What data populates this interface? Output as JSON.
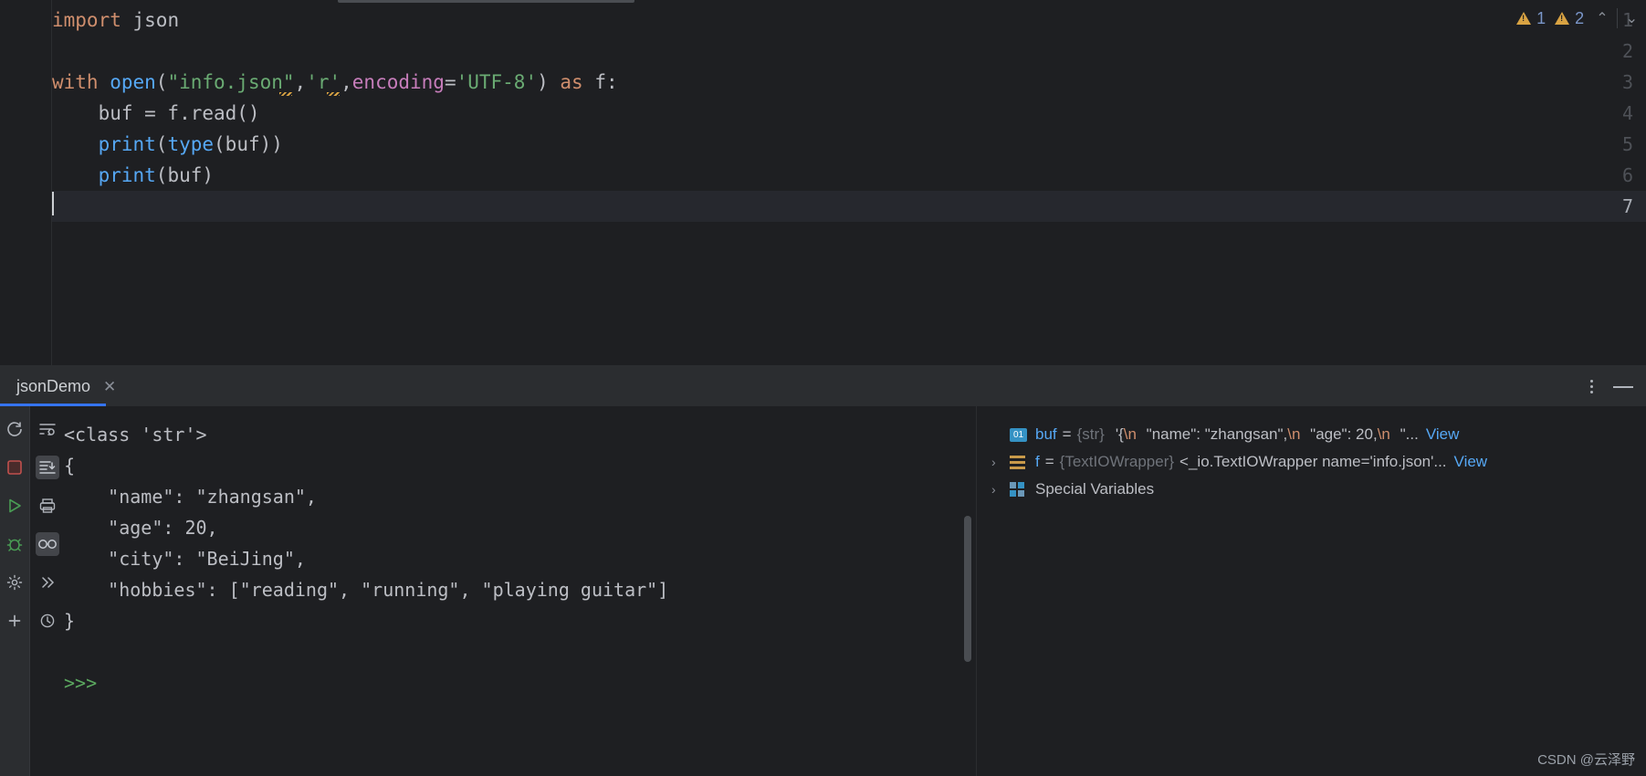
{
  "editor": {
    "lines": [
      {
        "number": "1",
        "tokens": [
          {
            "t": "import ",
            "c": "kw"
          },
          {
            "t": "json",
            "c": "plain"
          }
        ]
      },
      {
        "number": "2",
        "tokens": []
      },
      {
        "number": "3",
        "tokens": [
          {
            "t": "with ",
            "c": "kw"
          },
          {
            "t": "open",
            "c": "fn"
          },
          {
            "t": "(",
            "c": "plain"
          },
          {
            "t": "\"info.json\"",
            "c": "str"
          },
          {
            "t": ",",
            "c": "plain"
          },
          {
            "t": "'r'",
            "c": "str"
          },
          {
            "t": ",",
            "c": "plain"
          },
          {
            "t": "encoding",
            "c": "param"
          },
          {
            "t": "=",
            "c": "plain"
          },
          {
            "t": "'UTF-8'",
            "c": "str"
          },
          {
            "t": ") ",
            "c": "plain"
          },
          {
            "t": "as",
            "c": "kw"
          },
          {
            "t": " f:",
            "c": "plain"
          }
        ]
      },
      {
        "number": "4",
        "tokens": [
          {
            "t": "    buf = f.read()",
            "c": "plain"
          }
        ]
      },
      {
        "number": "5",
        "tokens": [
          {
            "t": "    ",
            "c": "plain"
          },
          {
            "t": "print",
            "c": "fn"
          },
          {
            "t": "(",
            "c": "plain"
          },
          {
            "t": "type",
            "c": "fn"
          },
          {
            "t": "(buf))",
            "c": "plain"
          }
        ]
      },
      {
        "number": "6",
        "tokens": [
          {
            "t": "    ",
            "c": "plain"
          },
          {
            "t": "print",
            "c": "fn"
          },
          {
            "t": "(buf)",
            "c": "plain"
          }
        ]
      },
      {
        "number": "7",
        "tokens": []
      }
    ],
    "current_line": "7",
    "inspections": {
      "warning_count_1": "1",
      "warning_count_2": "2",
      "prev_label": "⌃",
      "next_label": "⌄"
    }
  },
  "run_window": {
    "tab_label": "jsonDemo",
    "tab_close_label": "✕",
    "left_rail": [
      {
        "name": "rerun-icon",
        "glyph": "rerun"
      },
      {
        "name": "stop-icon",
        "glyph": "stop"
      },
      {
        "name": "run-icon",
        "glyph": "run"
      },
      {
        "name": "debug-icon",
        "glyph": "debug"
      },
      {
        "name": "settings-icon",
        "glyph": "gear"
      },
      {
        "name": "add-icon",
        "glyph": "plus"
      }
    ],
    "second_rail": [
      {
        "name": "soft-wrap-icon",
        "glyph": "wrap"
      },
      {
        "name": "scroll-to-end-icon",
        "glyph": "scrollend"
      },
      {
        "name": "print-icon",
        "glyph": "print"
      },
      {
        "name": "show-variables-icon",
        "glyph": "glasses"
      },
      {
        "name": "more-icon",
        "glyph": "chevrons"
      },
      {
        "name": "history-icon",
        "glyph": "clock"
      }
    ],
    "console_output": [
      {
        "text": "<class 'str'>",
        "style": "normal"
      },
      {
        "text": "{",
        "style": "normal"
      },
      {
        "text": "    \"name\": \"zhangsan\",",
        "style": "normal"
      },
      {
        "text": "    \"age\": 20,",
        "style": "normal"
      },
      {
        "text": "    \"city\": \"BeiJing\",",
        "style": "normal"
      },
      {
        "text": "    \"hobbies\": [\"reading\", \"running\", \"playing guitar\"]",
        "style": "normal"
      },
      {
        "text": "}",
        "style": "normal"
      },
      {
        "text": "",
        "style": "normal"
      },
      {
        "text": ">>>",
        "style": "prompt"
      }
    ],
    "more_options_label": "⋮",
    "minimize_label": "—"
  },
  "variables": {
    "rows": [
      {
        "expandable": false,
        "arrow": "",
        "icon": "badge-01",
        "name": "buf",
        "eq": "=",
        "type": "{str}",
        "value_pre": "'{",
        "value_esc1": "\\n",
        "value_mid1": "    \"name\": \"zhangsan\",",
        "value_esc2": "\\n",
        "value_mid2": "    \"age\": 20,",
        "value_esc3": "\\n",
        "value_tail": "    \"",
        "ellipsis": "...",
        "view_label": "View"
      },
      {
        "expandable": true,
        "arrow": "›",
        "icon": "lines",
        "name": "f",
        "eq": "=",
        "type": "{TextIOWrapper}",
        "value": "<_io.TextIOWrapper name='info.json'",
        "ellipsis": "...",
        "view_label": "View"
      },
      {
        "expandable": true,
        "arrow": "›",
        "icon": "grid",
        "name": "",
        "label": "Special Variables"
      }
    ]
  },
  "watermark": "CSDN @云泽野",
  "colors": {
    "editor_bg": "#1e1f22",
    "panel_bg": "#2b2d30",
    "accent_blue": "#3574f0",
    "keyword": "#cf8e6d",
    "function": "#56a8f5",
    "string": "#6aab73",
    "parameter": "#c77dbb",
    "warning": "#d9a343",
    "prompt_green": "#5ba85f"
  }
}
